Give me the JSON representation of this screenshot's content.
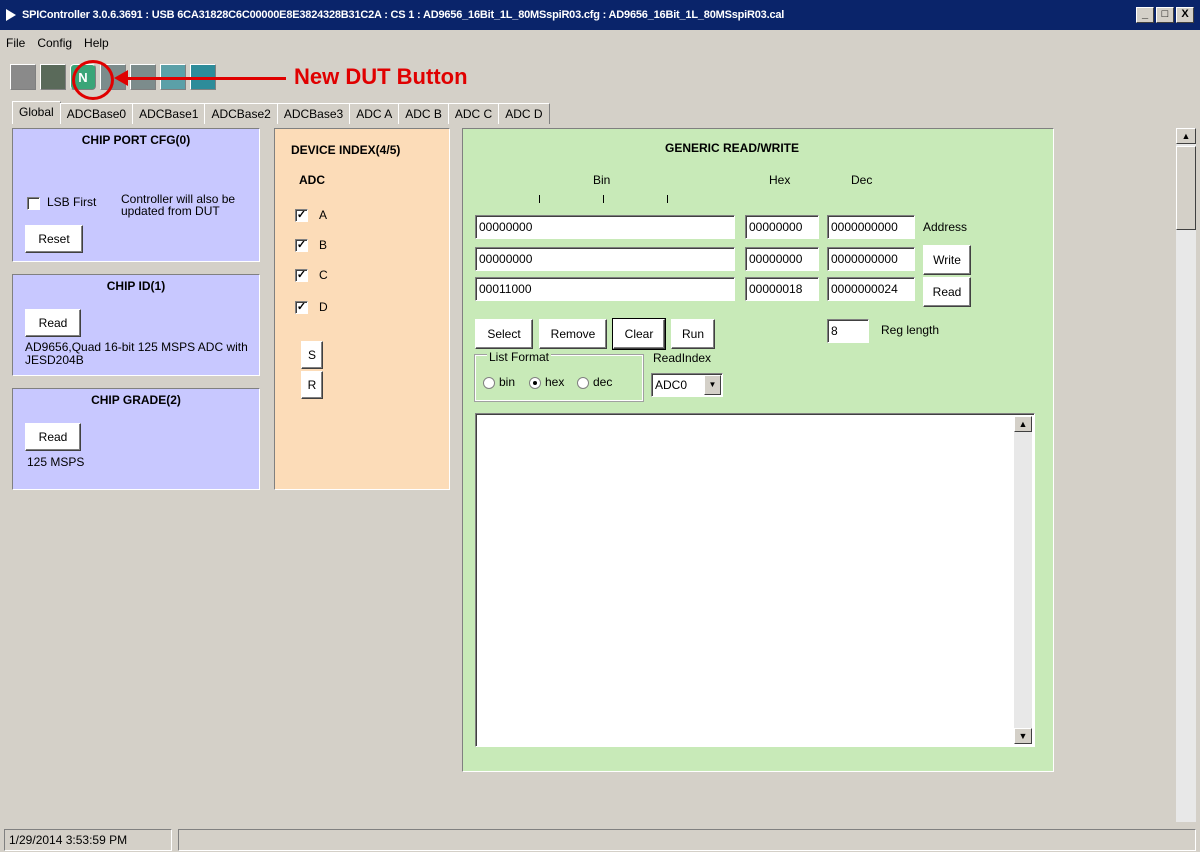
{
  "window": {
    "title": "SPIController 3.0.6.3691 : USB 6CA31828C6C00000E8E3824328B31C2A : CS 1 : AD9656_16Bit_1L_80MSspiR03.cfg : AD9656_16Bit_1L_80MSspiR03.cal",
    "minimize": "_",
    "maximize": "□",
    "close": "X"
  },
  "menu": [
    "File",
    "Config",
    "Help"
  ],
  "toolbar": {
    "new_dut_glyph": "N",
    "annotation": "New DUT Button",
    "annotation_color": "#e00000"
  },
  "tabs": [
    "Global",
    "ADCBase0",
    "ADCBase1",
    "ADCBase2",
    "ADCBase3",
    "ADC A",
    "ADC B",
    "ADC C",
    "ADC D"
  ],
  "chip_port_cfg": {
    "title": "CHIP PORT CFG(0)",
    "lsb_label": "LSB First",
    "note": "Controller will also be updated from DUT",
    "reset": "Reset"
  },
  "chip_id": {
    "title": "CHIP ID(1)",
    "read": "Read",
    "value": "AD9656,Quad 16-bit 125 MSPS ADC with JESD204B"
  },
  "chip_grade": {
    "title": "CHIP GRADE(2)",
    "read": "Read",
    "value": "125 MSPS"
  },
  "device_index": {
    "title": "DEVICE INDEX(4/5)",
    "adc_label": "ADC",
    "channels": [
      "A",
      "B",
      "C",
      "D"
    ],
    "checked_mark": "✓",
    "s_button": "S",
    "r_button": "R"
  },
  "generic_rw": {
    "title": "GENERIC READ/WRITE",
    "col_bin": "Bin",
    "col_hex": "Hex",
    "col_dec": "Dec",
    "rows": [
      {
        "bin": "00000000",
        "hex": "00000000",
        "dec": "0000000000",
        "side": "Address"
      },
      {
        "bin": "00000000",
        "hex": "00000000",
        "dec": "0000000000",
        "side": "Write"
      },
      {
        "bin": "00011000",
        "hex": "00000018",
        "dec": "0000000024",
        "side": "Read"
      }
    ],
    "buttons": {
      "select": "Select",
      "remove": "Remove",
      "clear": "Clear",
      "run": "Run"
    },
    "reg_length_value": "8",
    "reg_length_label": "Reg length",
    "list_format": {
      "label": "List Format",
      "options": [
        "bin",
        "hex",
        "dec"
      ],
      "selected": "hex"
    },
    "read_index": {
      "label": "ReadIndex",
      "value": "ADC0"
    }
  },
  "status": {
    "datetime": "1/29/2014 3:53:59 PM"
  }
}
